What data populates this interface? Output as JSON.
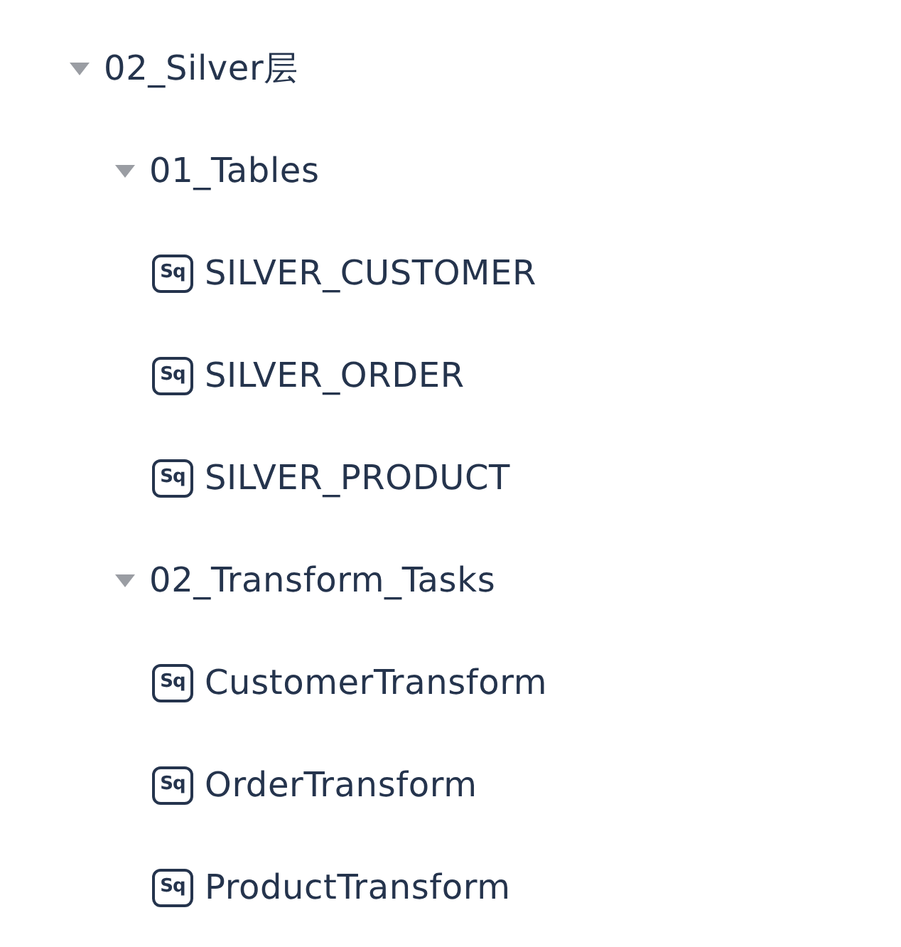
{
  "tree": [
    {
      "label": "02_Silver层",
      "expanded": true,
      "children": [
        {
          "label": "01_Tables",
          "expanded": true,
          "children": [
            {
              "label": "SILVER_CUSTOMER",
              "tag": "Sq"
            },
            {
              "label": "SILVER_ORDER",
              "tag": "Sq"
            },
            {
              "label": "SILVER_PRODUCT",
              "tag": "Sq"
            }
          ]
        },
        {
          "label": "02_Transform_Tasks",
          "expanded": true,
          "children": [
            {
              "label": "CustomerTransform",
              "tag": "Sq"
            },
            {
              "label": "OrderTransform",
              "tag": "Sq"
            },
            {
              "label": "ProductTransform",
              "tag": "Sq"
            }
          ]
        }
      ]
    }
  ]
}
